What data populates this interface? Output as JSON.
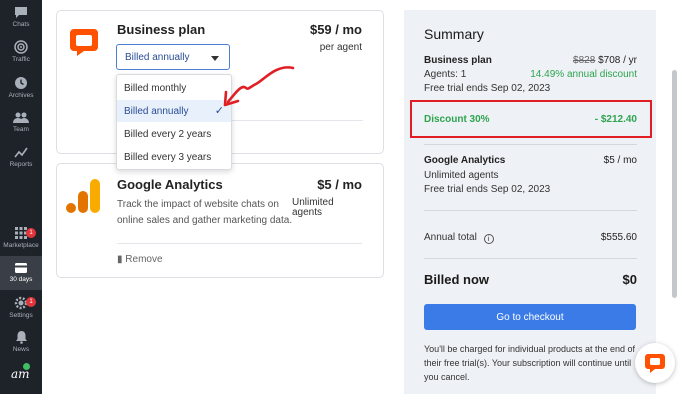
{
  "sidebar": {
    "items": [
      {
        "label": "Chats",
        "icon": "chat-icon"
      },
      {
        "label": "Traffic",
        "icon": "traffic-icon"
      },
      {
        "label": "Archives",
        "icon": "archives-icon"
      },
      {
        "label": "Team",
        "icon": "team-icon"
      },
      {
        "label": "Reports",
        "icon": "reports-icon"
      }
    ],
    "bottom_items": [
      {
        "label": "Marketplace",
        "icon": "marketplace-icon",
        "badge": "1"
      },
      {
        "label": "30 days",
        "icon": "card-icon",
        "active": true
      },
      {
        "label": "Settings",
        "icon": "settings-icon",
        "badge": "1"
      },
      {
        "label": "News",
        "icon": "bell-icon"
      }
    ],
    "avatar_text": "am"
  },
  "business_plan": {
    "title": "Business plan",
    "price": "$59 / mo",
    "price_sub": "per agent",
    "billing_selected": "Billed annually",
    "billing_options": [
      "Billed monthly",
      "Billed annually",
      "Billed every 2 years",
      "Billed every 3 years"
    ],
    "selected_index": 1
  },
  "google_analytics": {
    "title": "Google Analytics",
    "desc_line1": "Track the impact of website chats on",
    "desc_line2": "online sales and gather marketing data.",
    "price": "$5 / mo",
    "price_sub1": "Unlimited",
    "price_sub2": "agents",
    "remove_label": "Remove"
  },
  "summary": {
    "title": "Summary",
    "business_plan": {
      "name": "Business plan",
      "old_price": "$828",
      "new_price": "$708 / yr",
      "agents": "Agents: 1",
      "discount_pct": "14.49% annual discount",
      "trial": "Free trial ends Sep 02, 2023"
    },
    "discount": {
      "label": "Discount 30%",
      "amount": "- $212.40"
    },
    "google_analytics": {
      "name": "Google Analytics",
      "price": "$5 / mo",
      "agents": "Unlimited agents",
      "trial": "Free trial ends Sep 02, 2023"
    },
    "annual_total_label": "Annual total",
    "annual_total_value": "$555.60",
    "billed_now_label": "Billed now",
    "billed_now_value": "$0",
    "checkout_label": "Go to checkout",
    "note_line1": "You'll be charged for individual products at the end of",
    "note_line2": "their free trial(s). Your subscription will continue until",
    "note_line3": "you cancel."
  },
  "colors": {
    "sidebar_bg": "#1e2229",
    "accent_blue": "#3b7be8",
    "discount_green": "#2ea44f",
    "highlight_red": "#e01e24",
    "livechat_orange": "#ff5100",
    "ga_orange": "#f9ab00"
  }
}
